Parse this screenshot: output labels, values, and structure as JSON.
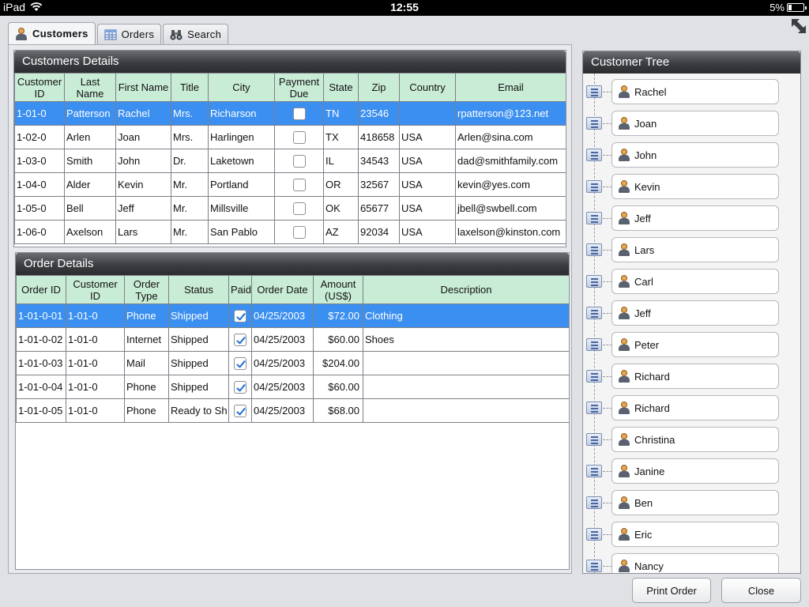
{
  "status_bar": {
    "device": "iPad",
    "time": "12:55",
    "battery": "5%"
  },
  "tabs": [
    {
      "label": "Customers",
      "active": true,
      "icon": "person-icon"
    },
    {
      "label": "Orders",
      "active": false,
      "icon": "grid-icon"
    },
    {
      "label": "Search",
      "active": false,
      "icon": "binoculars-icon"
    }
  ],
  "customers_panel": {
    "title": "Customers Details",
    "columns": [
      "Customer ID",
      "Last Name",
      "First Name",
      "Title",
      "City",
      "Payment Due",
      "State",
      "Zip",
      "Country",
      "Email"
    ],
    "rows": [
      [
        "1-01-0",
        "Patterson",
        "Rachel",
        "Mrs.",
        "Richarson",
        "",
        "TN",
        "23546",
        "",
        "rpatterson@123.net"
      ],
      [
        "1-02-0",
        "Arlen",
        "Joan",
        "Mrs.",
        "Harlingen",
        "",
        "TX",
        "418658",
        "USA",
        "Arlen@sina.com"
      ],
      [
        "1-03-0",
        "Smith",
        "John",
        "Dr.",
        "Laketown",
        "",
        "IL",
        "34543",
        "USA",
        "dad@smithfamily.com"
      ],
      [
        "1-04-0",
        "Alder",
        "Kevin",
        "Mr.",
        "Portland",
        "",
        "OR",
        "32567",
        "USA",
        "kevin@yes.com"
      ],
      [
        "1-05-0",
        "Bell",
        "Jeff",
        "Mr.",
        "Millsville",
        "",
        "OK",
        "65677",
        "USA",
        "jbell@swbell.com"
      ],
      [
        "1-06-0",
        "Axelson",
        "Lars",
        "Mr.",
        "San Pablo",
        "",
        "AZ",
        "92034",
        "USA",
        "laxelson@kinston.com"
      ]
    ],
    "payment_due": [
      false,
      false,
      false,
      false,
      false,
      false
    ],
    "selected_row": 0
  },
  "orders_panel": {
    "title": "Order Details",
    "columns": [
      "Order ID",
      "Customer ID",
      "Order Type",
      "Status",
      "Paid",
      "Order Date",
      "Amount (US$)",
      "Description"
    ],
    "rows": [
      [
        "1-01-0-01",
        "1-01-0",
        "Phone",
        "Shipped",
        "",
        "04/25/2003",
        "$72.00",
        "Clothing"
      ],
      [
        "1-01-0-02",
        "1-01-0",
        "Internet",
        "Shipped",
        "",
        "04/25/2003",
        "$60.00",
        "Shoes"
      ],
      [
        "1-01-0-03",
        "1-01-0",
        "Mail",
        "Shipped",
        "",
        "04/25/2003",
        "$204.00",
        ""
      ],
      [
        "1-01-0-04",
        "1-01-0",
        "Phone",
        "Shipped",
        "",
        "04/25/2003",
        "$60.00",
        ""
      ],
      [
        "1-01-0-05",
        "1-01-0",
        "Phone",
        "Ready to Sh",
        "",
        "04/25/2003",
        "$68.00",
        ""
      ]
    ],
    "paid": [
      true,
      true,
      true,
      true,
      true
    ],
    "selected_row": 0
  },
  "tree_panel": {
    "title": "Customer Tree",
    "nodes": [
      "Rachel",
      "Joan",
      "John",
      "Kevin",
      "Jeff",
      "Lars",
      "Carl",
      "Jeff",
      "Peter",
      "Richard",
      "Richard",
      "Christina",
      "Janine",
      "Ben",
      "Eric",
      "Nancy"
    ]
  },
  "buttons": {
    "print_order": "Print Order",
    "close": "Close"
  },
  "colors": {
    "selection": "#3b8ff0",
    "header_green": "#c9ecd6",
    "panel_header": "#3b3d41"
  }
}
